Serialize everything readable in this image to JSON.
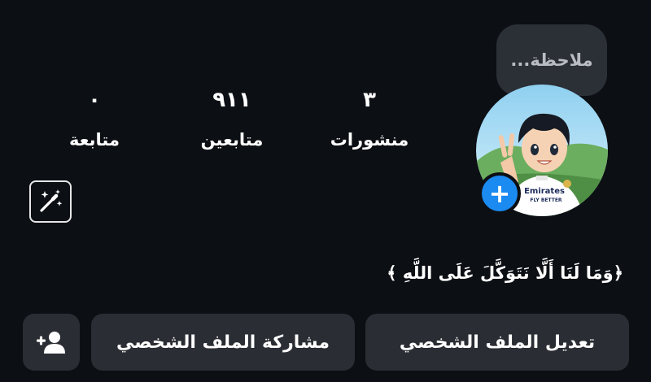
{
  "note": {
    "placeholder": "ملاحظة..."
  },
  "stats": {
    "posts": {
      "count": "٣",
      "label": "منشورات"
    },
    "followers": {
      "count": "٩١١",
      "label": "متابعين"
    },
    "following": {
      "count": "٠",
      "label": "متابعة"
    }
  },
  "bio": {
    "text": "﴿وَمَا لَنَا أَلَّا نَتَوَكَّلَ عَلَى اللَّهِ ﴾"
  },
  "avatar": {
    "shirt_text_1": "Emirates",
    "shirt_text_2": "FLY BETTER"
  },
  "buttons": {
    "edit_profile": "تعديل الملف الشخصي",
    "share_profile": "مشاركة الملف الشخصي"
  },
  "colors": {
    "background": "#0c0f14",
    "button_bg": "#2a2d33",
    "accent_blue": "#1b8af1",
    "note_bg": "#2b2f36"
  },
  "icons": {
    "add_story": "plus-icon",
    "wand": "magic-wand-icon",
    "add_user": "add-person-icon"
  }
}
